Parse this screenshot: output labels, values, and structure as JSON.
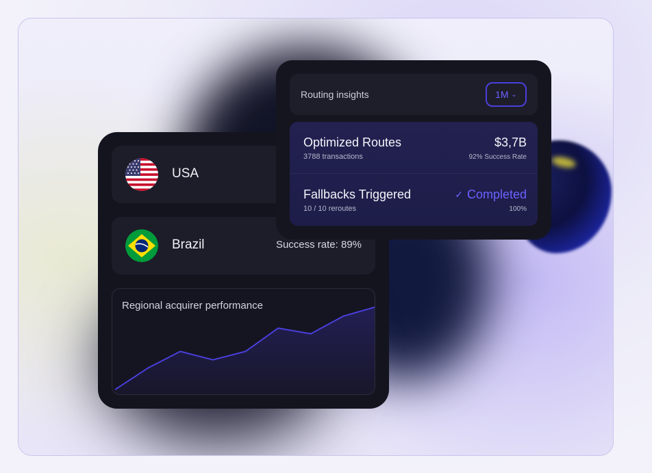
{
  "countries": [
    {
      "name": "USA",
      "flag_icon": "usa-flag-icon"
    },
    {
      "name": "Brazil",
      "flag_icon": "brazil-flag-icon",
      "success_rate": "Success rate: 89%"
    }
  ],
  "chart": {
    "title": "Regional acquirer performance"
  },
  "chart_data": {
    "type": "area",
    "title": "Regional acquirer performance",
    "xlabel": "",
    "ylabel": "",
    "x": [
      0,
      1,
      2,
      3,
      4,
      5,
      6,
      7,
      8
    ],
    "series": [
      {
        "values": [
          5,
          28,
          46,
          37,
          46,
          71,
          65,
          84,
          94
        ]
      }
    ],
    "ylim": [
      0,
      100
    ],
    "grid": false,
    "colors": {
      "line": "#4a3fdc",
      "fill": "#24205a"
    }
  },
  "insights": {
    "title": "Routing insights",
    "period": "1M",
    "routes": [
      {
        "name": "Optimized Routes",
        "sub": "3788 transactions",
        "value": "$3,7B",
        "meta": "92% Success Rate"
      },
      {
        "name": "Fallbacks Triggered",
        "sub": "10 / 10 reroutes",
        "value": "Completed",
        "meta": "100%"
      }
    ]
  },
  "colors": {
    "accent": "#4a3fdc",
    "card_bg": "#14141f"
  }
}
